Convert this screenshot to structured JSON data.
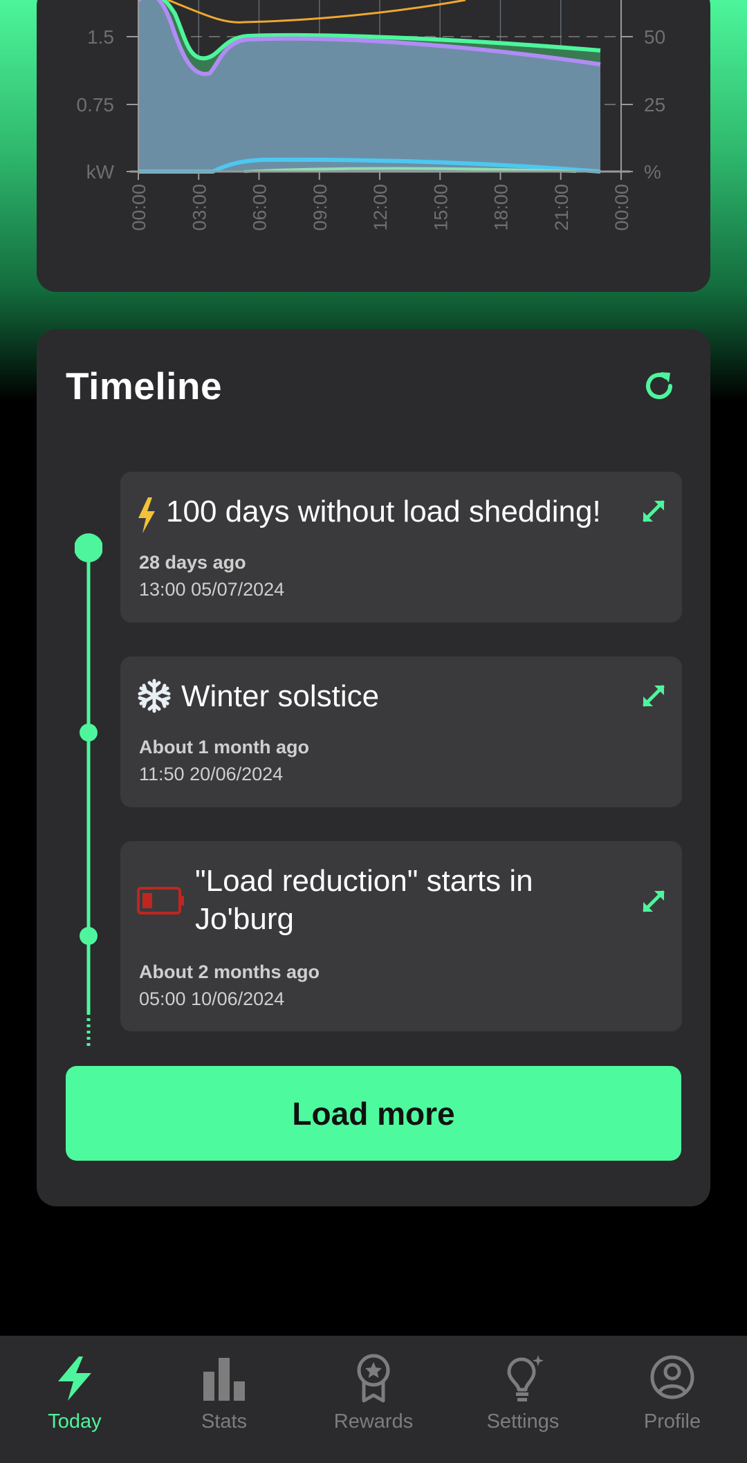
{
  "chart_data": {
    "type": "area",
    "x_ticks": [
      "00:00",
      "03:00",
      "06:00",
      "09:00",
      "12:00",
      "15:00",
      "18:00",
      "21:00",
      "00:00"
    ],
    "y_left_ticks": [
      "kW",
      "0.75",
      "1.5"
    ],
    "y_right_ticks": [
      "%",
      "25",
      "50"
    ],
    "y_left_range": [
      0,
      2.25
    ],
    "y_right_range": [
      0,
      75
    ],
    "grid": true,
    "series_colors": [
      "#4ef59c",
      "#b18cf5",
      "#f0a830",
      "#4cc8f0",
      "#7fa3b8"
    ]
  },
  "timeline": {
    "title": "Timeline",
    "refresh_icon": "refresh-icon",
    "events": [
      {
        "icon": "lightning-icon",
        "title": "100 days without load shedding!",
        "relative": "28 days ago",
        "datetime": "13:00 05/07/2024"
      },
      {
        "icon": "snowflake-icon",
        "title": "Winter solstice",
        "relative": "About 1 month ago",
        "datetime": "11:50 20/06/2024"
      },
      {
        "icon": "battery-low-icon",
        "title": "\"Load reduction\" starts in Jo'burg",
        "relative": "About 2 months ago",
        "datetime": "05:00 10/06/2024"
      }
    ],
    "load_more_label": "Load more"
  },
  "nav": {
    "items": [
      {
        "label": "Today",
        "icon": "lightning-icon",
        "active": true
      },
      {
        "label": "Stats",
        "icon": "bar-chart-icon",
        "active": false
      },
      {
        "label": "Rewards",
        "icon": "medal-icon",
        "active": false
      },
      {
        "label": "Settings",
        "icon": "lightbulb-icon",
        "active": false
      },
      {
        "label": "Profile",
        "icon": "profile-icon",
        "active": false
      }
    ]
  },
  "colors": {
    "accent": "#4ef59c",
    "card": "#2b2b2d",
    "event_card": "#3a3a3c",
    "lightning": "#f3c13a",
    "battery": "#c0261f"
  }
}
